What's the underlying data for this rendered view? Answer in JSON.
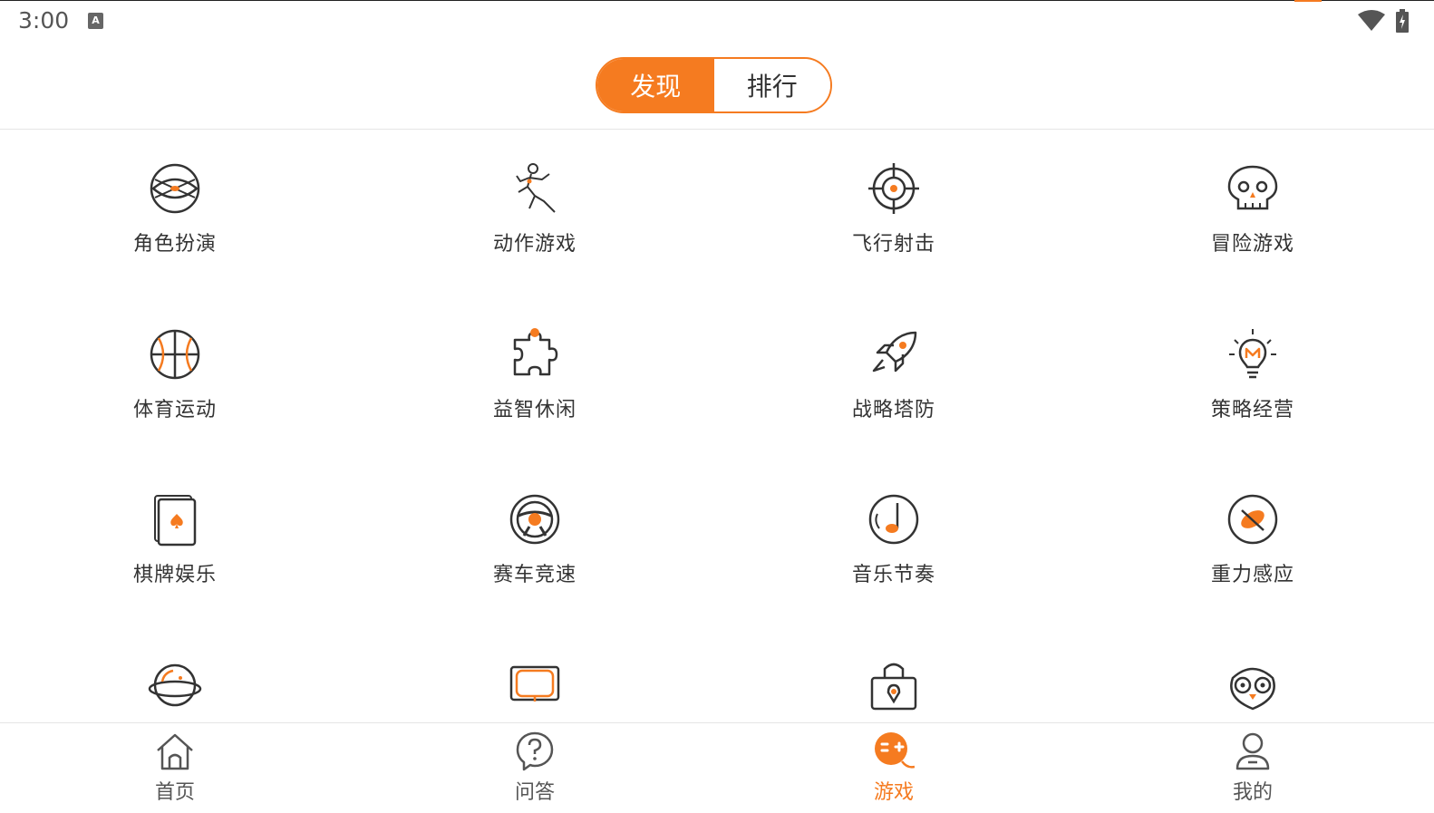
{
  "status_bar": {
    "time": "3:00",
    "a_icon_letter": "A",
    "icons": [
      "a-icon",
      "wifi-icon",
      "battery-icon"
    ]
  },
  "header": {
    "tabs": [
      {
        "label": "发现",
        "active": true
      },
      {
        "label": "排行",
        "active": false
      }
    ]
  },
  "categories": [
    {
      "label": "角色扮演",
      "icon": "role-play-icon"
    },
    {
      "label": "动作游戏",
      "icon": "action-icon"
    },
    {
      "label": "飞行射击",
      "icon": "crosshair-icon"
    },
    {
      "label": "冒险游戏",
      "icon": "skull-icon"
    },
    {
      "label": "体育运动",
      "icon": "basketball-icon"
    },
    {
      "label": "益智休闲",
      "icon": "puzzle-icon"
    },
    {
      "label": "战略塔防",
      "icon": "rocket-icon"
    },
    {
      "label": "策略经营",
      "icon": "lightbulb-icon"
    },
    {
      "label": "棋牌娱乐",
      "icon": "cards-icon"
    },
    {
      "label": "赛车竞速",
      "icon": "steering-wheel-icon"
    },
    {
      "label": "音乐节奏",
      "icon": "music-note-icon"
    },
    {
      "label": "重力感应",
      "icon": "compass-icon"
    },
    {
      "label": "",
      "icon": "planet-icon"
    },
    {
      "label": "",
      "icon": "screen-icon"
    },
    {
      "label": "",
      "icon": "lock-location-icon"
    },
    {
      "label": "",
      "icon": "owl-icon"
    }
  ],
  "tabbar": {
    "items": [
      {
        "label": "首页",
        "icon": "home-icon",
        "active": false
      },
      {
        "label": "问答",
        "icon": "question-icon",
        "active": false
      },
      {
        "label": "游戏",
        "icon": "game-icon",
        "active": true
      },
      {
        "label": "我的",
        "icon": "profile-icon",
        "active": false
      }
    ]
  },
  "colors": {
    "accent": "#f57b20",
    "icon_stroke": "#333333",
    "text": "#333333"
  }
}
